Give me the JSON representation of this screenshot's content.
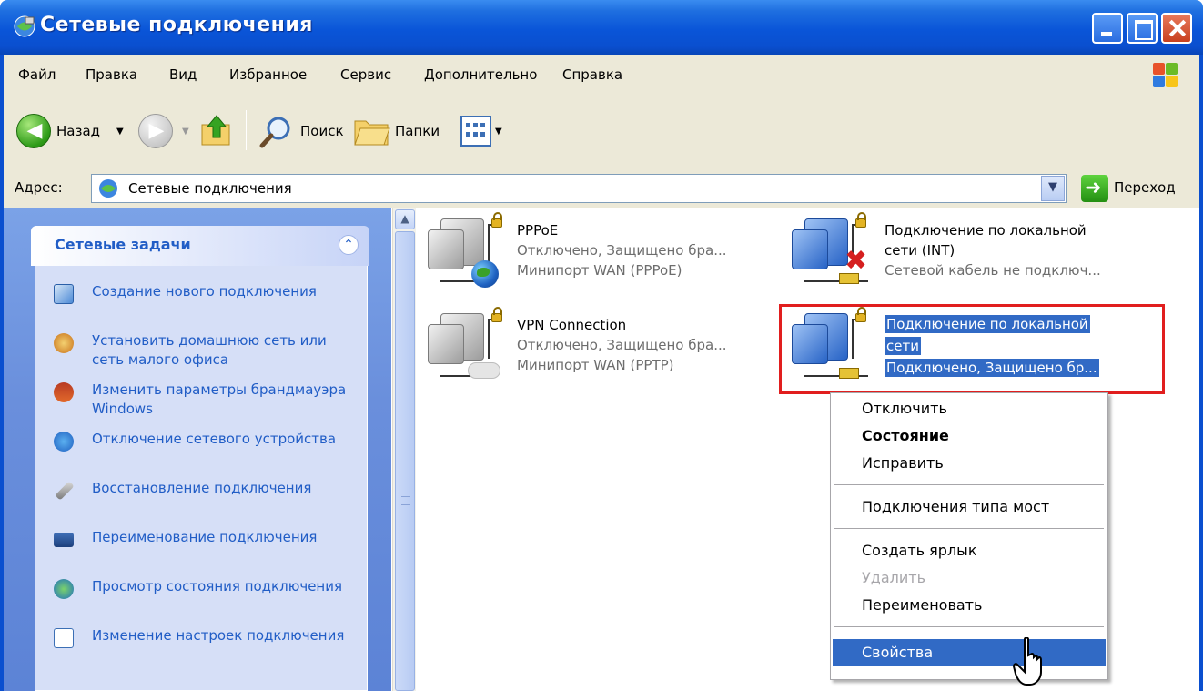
{
  "window": {
    "title": "Сетевые подключения",
    "icon": "network-connections-icon"
  },
  "menubar": {
    "items": [
      "Файл",
      "Правка",
      "Вид",
      "Избранное",
      "Сервис",
      "Дополнительно",
      "Справка"
    ]
  },
  "toolbar": {
    "back_label": "Назад",
    "search_label": "Поиск",
    "folders_label": "Папки"
  },
  "address": {
    "label": "Адрес:",
    "value": "Сетевые подключения",
    "go_label": "Переход"
  },
  "tasks": {
    "header": "Сетевые задачи",
    "items": [
      {
        "label": "Создание нового подключения",
        "icon": "new-connection-icon"
      },
      {
        "label": "Установить домашнюю сеть или сеть малого офиса",
        "icon": "home-network-icon"
      },
      {
        "label": "Изменить параметры брандмауэра Windows",
        "icon": "firewall-icon"
      },
      {
        "label": "Отключение сетевого устройства",
        "icon": "disable-device-icon"
      },
      {
        "label": "Восстановление подключения",
        "icon": "repair-icon"
      },
      {
        "label": "Переименование подключения",
        "icon": "rename-icon"
      },
      {
        "label": "Просмотр состояния подключения",
        "icon": "status-icon"
      },
      {
        "label": "Изменение настроек подключения",
        "icon": "settings-icon"
      }
    ]
  },
  "connections": [
    {
      "name": "PPPoE",
      "status": "Отключено, Защищено бра...",
      "device": "Минипорт WAN (PPPoE)"
    },
    {
      "name_line1": "Подключение по локальной",
      "name_line2": "сети (INT)",
      "status": "Сетевой кабель не подключ..."
    },
    {
      "name": "VPN Connection",
      "status": "Отключено, Защищено бра...",
      "device": "Минипорт WAN (PPTP)"
    },
    {
      "name_line1": "Подключение по локальной",
      "name_line2": "сети",
      "status": "Подключено, Защищено бр...",
      "selected": true
    }
  ],
  "context_menu": {
    "items": [
      {
        "label": "Отключить"
      },
      {
        "label": "Состояние",
        "bold": true
      },
      {
        "label": "Исправить"
      },
      {
        "label": "Подключения типа мост"
      },
      {
        "label": "Создать ярлык"
      },
      {
        "label": "Удалить",
        "disabled": true
      },
      {
        "label": "Переименовать"
      },
      {
        "label": "Свойства",
        "selected": true
      }
    ]
  },
  "colors": {
    "titlebar": "#0a4fcf",
    "selection": "#316ac5",
    "highlight_border": "#e11e1e",
    "task_text": "#215dc6"
  }
}
